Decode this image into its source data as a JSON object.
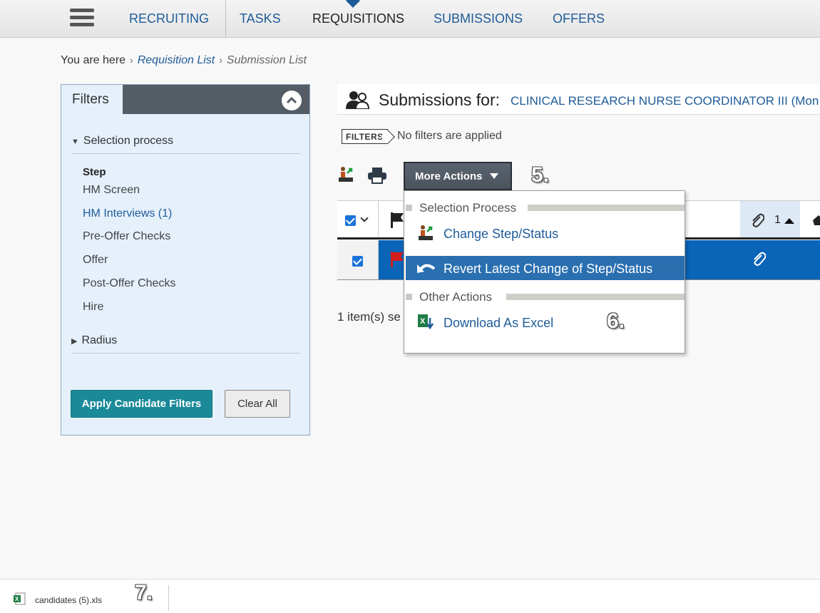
{
  "nav": {
    "items": [
      "RECRUITING",
      "TASKS",
      "REQUISITIONS",
      "SUBMISSIONS",
      "OFFERS"
    ],
    "active": "REQUISITIONS"
  },
  "breadcrumb": {
    "prefix": "You are here",
    "link": "Requisition List",
    "current": "Submission List"
  },
  "filters": {
    "title": "Filters",
    "selection_process": "Selection process",
    "step_label": "Step",
    "steps": [
      "HM Screen",
      "HM Interviews (1)",
      "Pre-Offer Checks",
      "Offer",
      "Post-Offer Checks",
      "Hire"
    ],
    "radius": "Radius",
    "apply_label": "Apply Candidate Filters",
    "clear_label": "Clear All"
  },
  "main": {
    "title": "Submissions for:",
    "requisition": "CLINICAL RESEARCH NURSE COORDINATOR III (Mon",
    "filters_tag": "FILTERS",
    "no_filters": "No filters are applied",
    "more_actions": "More Actions",
    "sort_count": "1",
    "selected_count": "1 item(s) se"
  },
  "dropdown": {
    "group1": "Selection Process",
    "change_step": "Change Step/Status",
    "revert": "Revert Latest Change of Step/Status",
    "group2": "Other Actions",
    "download": "Download As Excel"
  },
  "annotations": {
    "five": "5.",
    "six": "6.",
    "seven": "7."
  },
  "downloads": {
    "file": "candidates (5).xls"
  },
  "colors": {
    "link": "#1f5c99",
    "selected_row": "#0a64b8",
    "apply_button": "#1a8a99",
    "menu_highlight": "#2a6fb0"
  }
}
